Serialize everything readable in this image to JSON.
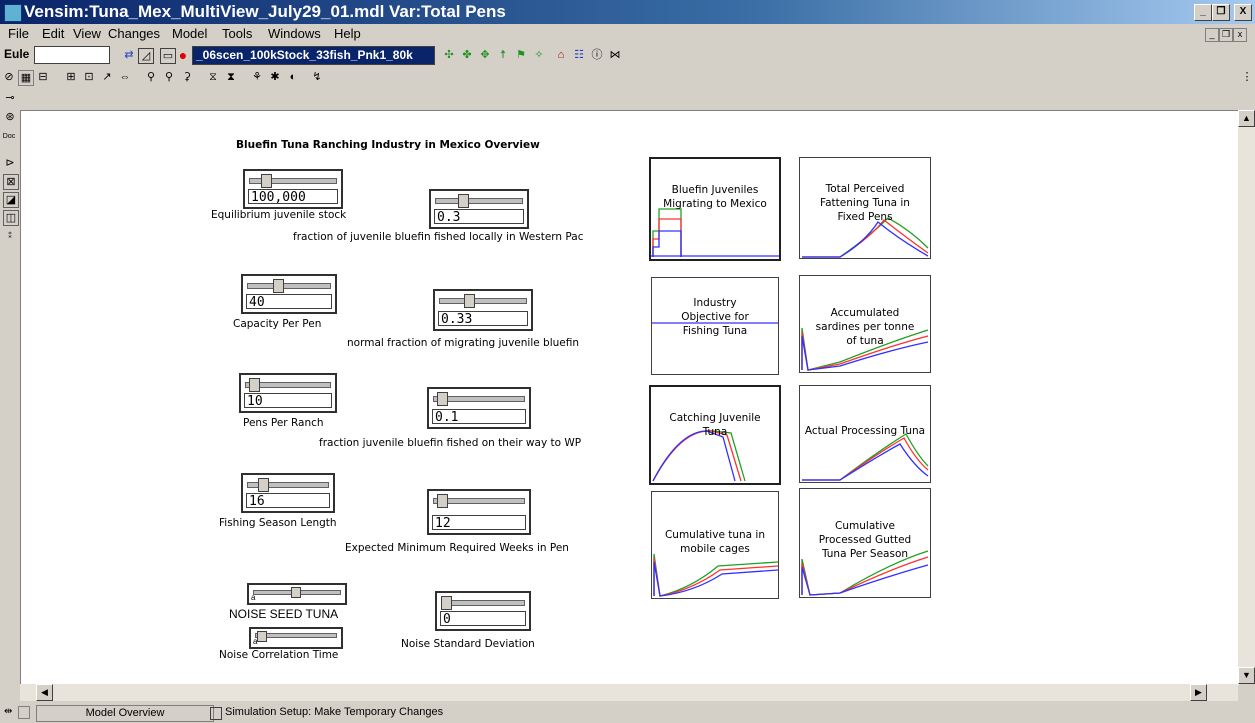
{
  "window": {
    "title": "Vensim:Tuna_Mex_MultiView_July29_01.mdl Var:Total Pens",
    "controls": [
      "_",
      "❒",
      "X"
    ],
    "mdi_controls": [
      "_",
      "❒",
      "x"
    ]
  },
  "menu": [
    "File",
    "Edit",
    "View",
    "Changes",
    "Model",
    "Tools",
    "Windows",
    "Help"
  ],
  "toolbar1": {
    "integration_label": "Eule",
    "integration_value": "",
    "run_name": "_06scen_100kStock_33fish_Pnk1_80k"
  },
  "canvas": {
    "heading": "Bluefin Tuna Ranching Industry in Mexico Overview",
    "sliders": [
      {
        "id": "eq-juvenile-stock",
        "value": "100,000",
        "label": "Equilibrium juvenile stock",
        "thumb": 0.15
      },
      {
        "id": "fraction-fished-locally",
        "value": "0.3",
        "label": "fraction of juvenile bluefin fished locally in Western Pac",
        "thumb": 0.3
      },
      {
        "id": "capacity-per-pen",
        "value": "40",
        "label": "Capacity Per Pen",
        "thumb": 0.35
      },
      {
        "id": "normal-fraction-migrating",
        "value": "0.33",
        "label": "normal fraction of migrating juvenile bluefin",
        "thumb": 0.33
      },
      {
        "id": "pens-per-ranch",
        "value": "10",
        "label": "Pens Per Ranch",
        "thumb": 0.05
      },
      {
        "id": "fraction-fished-on-way",
        "value": "0.1",
        "label": "fraction juvenile bluefin fished on their way to WP",
        "thumb": 0.05
      },
      {
        "id": "fishing-season-length",
        "value": "16",
        "label": "Fishing Season Length",
        "thumb": 0.15
      },
      {
        "id": "min-required-weeks",
        "value": "12",
        "label": "Expected Minimum Required Weeks in Pen",
        "thumb": 0.05
      },
      {
        "id": "noise-std-dev",
        "value": "0",
        "label": "Noise Standard Deviation",
        "thumb": 0.0
      }
    ],
    "small_sliders": [
      {
        "id": "noise-seed",
        "label": "NOISE SEED TUNA",
        "tick": "a"
      },
      {
        "id": "noise-corr-time",
        "label": "Noise Correlation Time",
        "tick": "a"
      }
    ],
    "graphs": [
      {
        "id": "bluefin-juveniles",
        "title": "Bluefin Juveniles Migrating to Mexico"
      },
      {
        "id": "total-perceived-fattening",
        "title": "Total Perceived Fattening Tuna in Fixed Pens"
      },
      {
        "id": "industry-objective",
        "title": "Industry Objective for Fishing Tuna"
      },
      {
        "id": "accumulated-sardines",
        "title": "Accumulated sardines per tonne of tuna"
      },
      {
        "id": "catching-juvenile",
        "title": "Catching Juvenile Tuna"
      },
      {
        "id": "actual-processing",
        "title": "Actual Processing Tuna"
      },
      {
        "id": "cumulative-mobile",
        "title": "Cumulative tuna in mobile cages"
      },
      {
        "id": "cumulative-processed",
        "title": "Cumulative Processed Gutted Tuna Per Season"
      }
    ],
    "series_colors": {
      "blue": "#3030ff",
      "red": "#ff3030",
      "green": "#20a020"
    }
  },
  "status": {
    "tab1": "Model Overview",
    "tab2": "Simulation Setup: Make Temporary Changes"
  }
}
